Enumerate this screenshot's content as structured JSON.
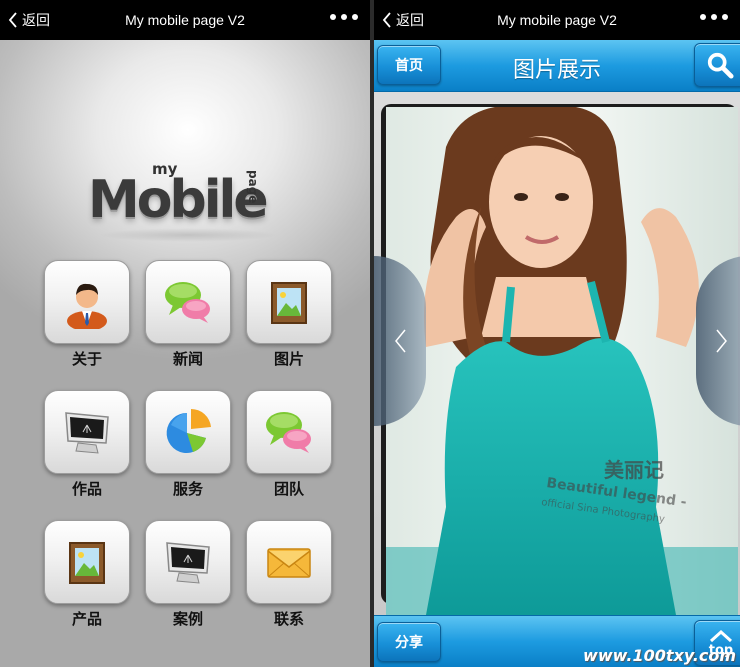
{
  "left": {
    "statusbar": {
      "back_label": "返回",
      "title": "My mobile page V2"
    },
    "logo": {
      "my": "my",
      "mobile": "Mobile",
      "page": "page"
    },
    "tiles": [
      {
        "label": "关于",
        "icon": "user-icon"
      },
      {
        "label": "新闻",
        "icon": "chat-icon"
      },
      {
        "label": "图片",
        "icon": "picture-frame-icon"
      },
      {
        "label": "作品",
        "icon": "monitor-icon"
      },
      {
        "label": "服务",
        "icon": "pie-chart-icon"
      },
      {
        "label": "团队",
        "icon": "chat-icon"
      },
      {
        "label": "产品",
        "icon": "picture-frame-icon"
      },
      {
        "label": "案例",
        "icon": "monitor-icon"
      },
      {
        "label": "联系",
        "icon": "envelope-icon"
      }
    ]
  },
  "right": {
    "statusbar": {
      "back_label": "返回",
      "title": "My mobile page V2"
    },
    "header": {
      "home_label": "首页",
      "title": "图片展示",
      "search_icon": "search-icon"
    },
    "photo_watermark": {
      "brand": "美丽记",
      "line1": "Beautiful legend -",
      "line2": "official Sina Photography"
    },
    "footer": {
      "share_label": "分享",
      "top_label": "top"
    },
    "site_watermark": "www.100txy.com"
  },
  "colors": {
    "accent_blue": "#1d9be0",
    "status_bar": "#000000",
    "home_bg": "#c4c4c4"
  }
}
